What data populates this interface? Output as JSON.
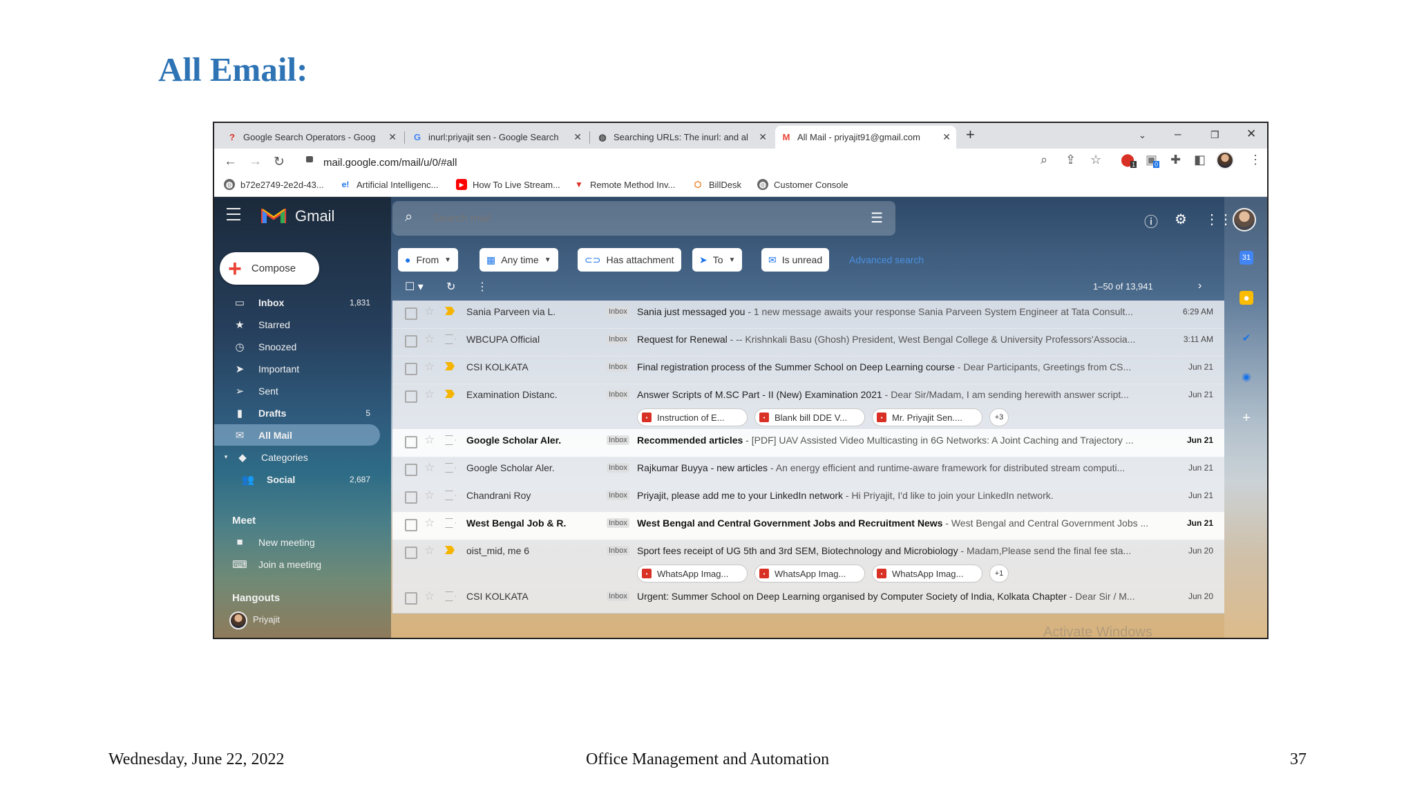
{
  "slide": {
    "title": "All Email:",
    "footer_date": "Wednesday, June 22, 2022",
    "footer_center": "Office Management and Automation",
    "page_number": "37"
  },
  "browser": {
    "tabs": [
      {
        "icon": "question-icon",
        "label": "Google Search Operators - Goog",
        "active": false
      },
      {
        "icon": "google-icon",
        "label": "inurl:priyajit sen - Google Search",
        "active": false
      },
      {
        "icon": "globe-icon",
        "label": "Searching URLs: The inurl: and al",
        "active": false
      },
      {
        "icon": "gmail-icon",
        "label": "All Mail - priyajit91@gmail.com",
        "active": true
      }
    ],
    "url": "mail.google.com/mail/u/0/#all",
    "bookmarks": [
      {
        "icon": "globe-icon",
        "label": "b72e2749-2e2d-43..."
      },
      {
        "icon": "e-icon",
        "label": "Artificial Intelligenc..."
      },
      {
        "icon": "youtube-icon",
        "label": "How To Live Stream..."
      },
      {
        "icon": "v-icon",
        "label": "Remote Method Inv..."
      },
      {
        "icon": "billdesk-icon",
        "label": "BillDesk"
      },
      {
        "icon": "globe-icon",
        "label": "Customer Console"
      }
    ],
    "extension_badges": [
      "1",
      "0"
    ]
  },
  "gmail": {
    "app_name": "Gmail",
    "search_placeholder": "Search mail",
    "compose_label": "Compose",
    "nav": [
      {
        "icon": "inbox-icon",
        "label": "Inbox",
        "count": "1,831",
        "bold": true
      },
      {
        "icon": "star-icon",
        "label": "Starred",
        "count": ""
      },
      {
        "icon": "clock-icon",
        "label": "Snoozed",
        "count": ""
      },
      {
        "icon": "important-icon",
        "label": "Important",
        "count": ""
      },
      {
        "icon": "send-icon",
        "label": "Sent",
        "count": ""
      },
      {
        "icon": "draft-icon",
        "label": "Drafts",
        "count": "5",
        "bold": true
      },
      {
        "icon": "mail-icon",
        "label": "All Mail",
        "count": "",
        "active": true,
        "bold": true
      },
      {
        "icon": "label-icon",
        "label": "Categories",
        "count": ""
      },
      {
        "icon": "people-icon",
        "label": "Social",
        "count": "2,687",
        "bold": true
      }
    ],
    "meet_title": "Meet",
    "meet_items": [
      {
        "icon": "video-icon",
        "label": "New meeting"
      },
      {
        "icon": "keyboard-icon",
        "label": "Join a meeting"
      }
    ],
    "hangouts_title": "Hangouts",
    "hangouts_user": "Priyajit",
    "filters": [
      {
        "icon": "account-icon",
        "label": "From",
        "dropdown": true
      },
      {
        "icon": "calendar-icon",
        "label": "Any time",
        "dropdown": true
      },
      {
        "icon": "attachment-icon",
        "label": "Has attachment",
        "dropdown": false
      },
      {
        "icon": "send-icon",
        "label": "To",
        "dropdown": true
      },
      {
        "icon": "unread-icon",
        "label": "Is unread",
        "dropdown": false
      }
    ],
    "advanced_search": "Advanced search",
    "pagination": "1–50 of 13,941",
    "emails": [
      {
        "sender": "Sania Parveen via L.",
        "tag": "Inbox",
        "subject": "Sania just messaged you",
        "snippet": " - 1 new message awaits your response Sania Parveen System Engineer at Tata Consult...",
        "date": "6:29 AM",
        "important": true,
        "unread": false,
        "attachments": []
      },
      {
        "sender": "WBCUPA Official",
        "tag": "Inbox",
        "subject": "Request for Renewal",
        "snippet": " - -- Krishnkali Basu (Ghosh) President, West Bengal College & University Professors'Associa...",
        "date": "3:11 AM",
        "important": false,
        "unread": false,
        "attachments": []
      },
      {
        "sender": "CSI KOLKATA",
        "tag": "Inbox",
        "subject": "Final registration process of the Summer School on Deep Learning course",
        "snippet": " - Dear Participants, Greetings from CS...",
        "date": "Jun 21",
        "important": true,
        "unread": false,
        "attachments": []
      },
      {
        "sender": "Examination Distanc.",
        "tag": "Inbox",
        "subject": "Answer Scripts of M.SC Part - II (New) Examination 2021",
        "snippet": " - Dear Sir/Madam, I am sending herewith answer script...",
        "date": "Jun 21",
        "important": true,
        "unread": false,
        "attachments": [
          "Instruction of E...",
          "Blank bill DDE V...",
          "Mr. Priyajit Sen...."
        ],
        "more": "+3"
      },
      {
        "sender": "Google Scholar Aler.",
        "tag": "Inbox",
        "subject": "Recommended articles",
        "snippet": " - [PDF] UAV Assisted Video Multicasting in 6G Networks: A Joint Caching and Trajectory ...",
        "date": "Jun 21",
        "important": false,
        "unread": true,
        "attachments": []
      },
      {
        "sender": "Google Scholar Aler.",
        "tag": "Inbox",
        "subject": "Rajkumar Buyya - new articles",
        "snippet": " - An energy efficient and runtime-aware framework for distributed stream computi...",
        "date": "Jun 21",
        "important": false,
        "unread": false,
        "attachments": []
      },
      {
        "sender": "Chandrani Roy",
        "tag": "Inbox",
        "subject": "Priyajit, please add me to your LinkedIn network",
        "snippet": " - Hi Priyajit, I'd like to join your LinkedIn network.",
        "date": "Jun 21",
        "important": false,
        "unread": false,
        "attachments": []
      },
      {
        "sender": "West Bengal Job & R.",
        "tag": "Inbox",
        "subject": "West Bengal and Central Government Jobs and Recruitment News",
        "snippet": " - West Bengal and Central Government Jobs ...",
        "date": "Jun 21",
        "important": false,
        "unread": true,
        "attachments": []
      },
      {
        "sender": "oist_mid, me 6",
        "tag": "Inbox",
        "subject": "Sport fees receipt of UG 5th and 3rd SEM, Biotechnology and Microbiology",
        "snippet": " - Madam,Please send the final fee sta...",
        "date": "Jun 20",
        "important": true,
        "unread": false,
        "attachments": [
          "WhatsApp Imag...",
          "WhatsApp Imag...",
          "WhatsApp Imag..."
        ],
        "more": "+1"
      },
      {
        "sender": "CSI KOLKATA",
        "tag": "Inbox",
        "subject": "Urgent: Summer School on Deep Learning organised by Computer Society of India, Kolkata Chapter",
        "snippet": " - Dear Sir / M...",
        "date": "Jun 20",
        "important": false,
        "unread": false,
        "attachments": []
      }
    ],
    "watermark": "Activate Windows"
  }
}
